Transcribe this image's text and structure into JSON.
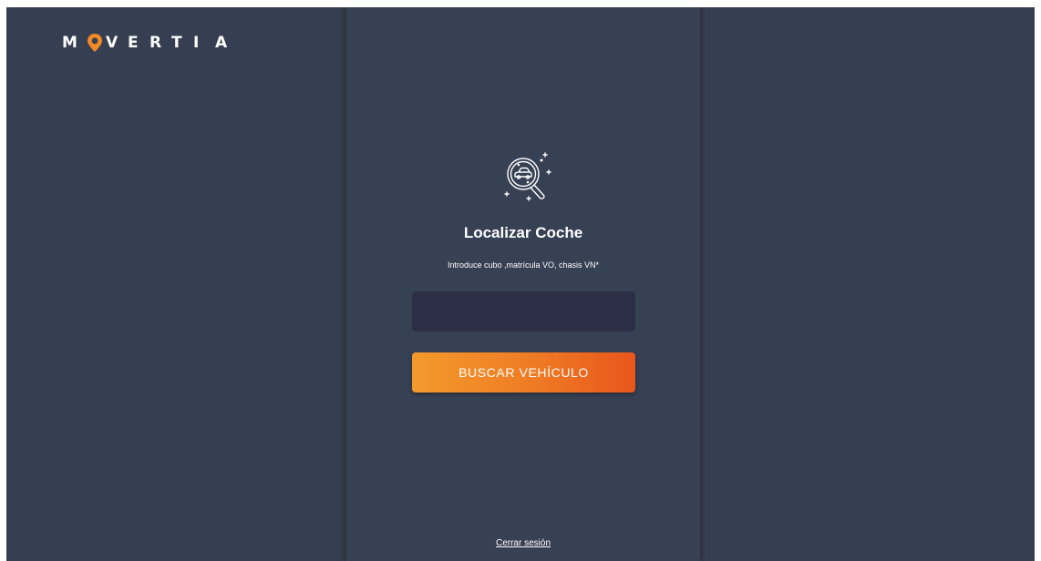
{
  "brand": {
    "letters_before": [
      "M"
    ],
    "letters_after": [
      "V",
      "E",
      "R",
      "T",
      "I",
      "A"
    ],
    "pin_icon": "location-pin-icon",
    "accent_color": "#f08a26"
  },
  "locator": {
    "icon": "car-magnifier-icon",
    "title": "Localizar Coche",
    "subtitle": "Introduce cubo ,matrícula VO, chasis VN*",
    "input_value": "",
    "button_label": "BUSCAR VEHÍCULO"
  },
  "footer": {
    "logout_label": "Cerrar sesión"
  },
  "colors": {
    "background": "#363f51",
    "panel": "#374154",
    "input_bg": "#2b2f47",
    "button_gradient_start": "#f39a2c",
    "button_gradient_end": "#e9561c"
  }
}
